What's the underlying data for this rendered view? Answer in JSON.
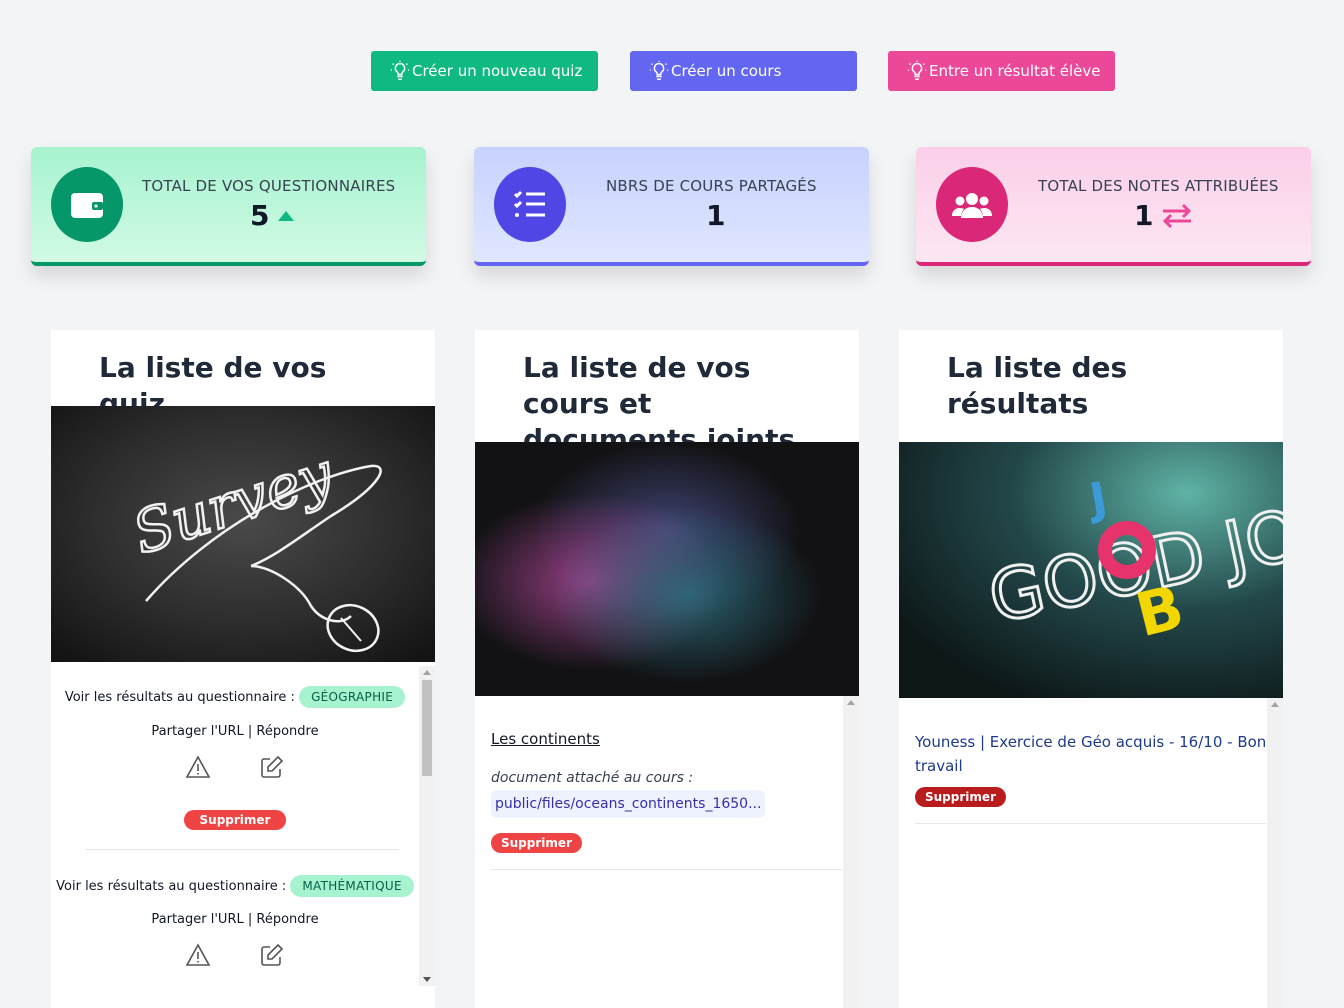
{
  "actions": {
    "new_quiz": "Créer un nouveau quiz",
    "new_course": "Créer un cours",
    "new_result": "Entre un résultat élève"
  },
  "stats": [
    {
      "label": "TOTAL DE VOS QUESTIONNAIRES",
      "value": "5",
      "trend_icon": "caret-up-icon"
    },
    {
      "label": "NBRS DE COURS PARTAGÉS",
      "value": "1"
    },
    {
      "label": "TOTAL DES NOTES ATTRIBUÉES",
      "value": "1",
      "trend_icon": "exchange-icon"
    }
  ],
  "colors": {
    "green": "#10b981",
    "indigo": "#6366f1",
    "pink": "#ec4899"
  },
  "quiz_card": {
    "title": "La liste de vos quiz",
    "image_text": "Survey",
    "items": [
      {
        "prefix": "Voir les résultats au questionnaire :",
        "subject": "GÉOGRAPHIE",
        "share": "Partager l'URL",
        "sep": "|",
        "answer": "Répondre",
        "delete": "Supprimer"
      },
      {
        "prefix": "Voir les résultats au questionnaire :",
        "subject": "MATHÉMATIQUE",
        "share": "Partager l'URL",
        "sep": "|",
        "answer": "Répondre"
      }
    ]
  },
  "course_card": {
    "title": "La liste de vos cours et documents joints",
    "course_title": "Les continents",
    "attached_label": "document attaché au cours :",
    "file": "public/files/oceans_continents_1650...",
    "delete": "Supprimer"
  },
  "results_card": {
    "title": "La liste des résultats",
    "image_text": "GOOD JOB",
    "result": "Youness | Exercice de Géo acquis - 16/10 - Bon travail",
    "delete": "Supprimer"
  }
}
